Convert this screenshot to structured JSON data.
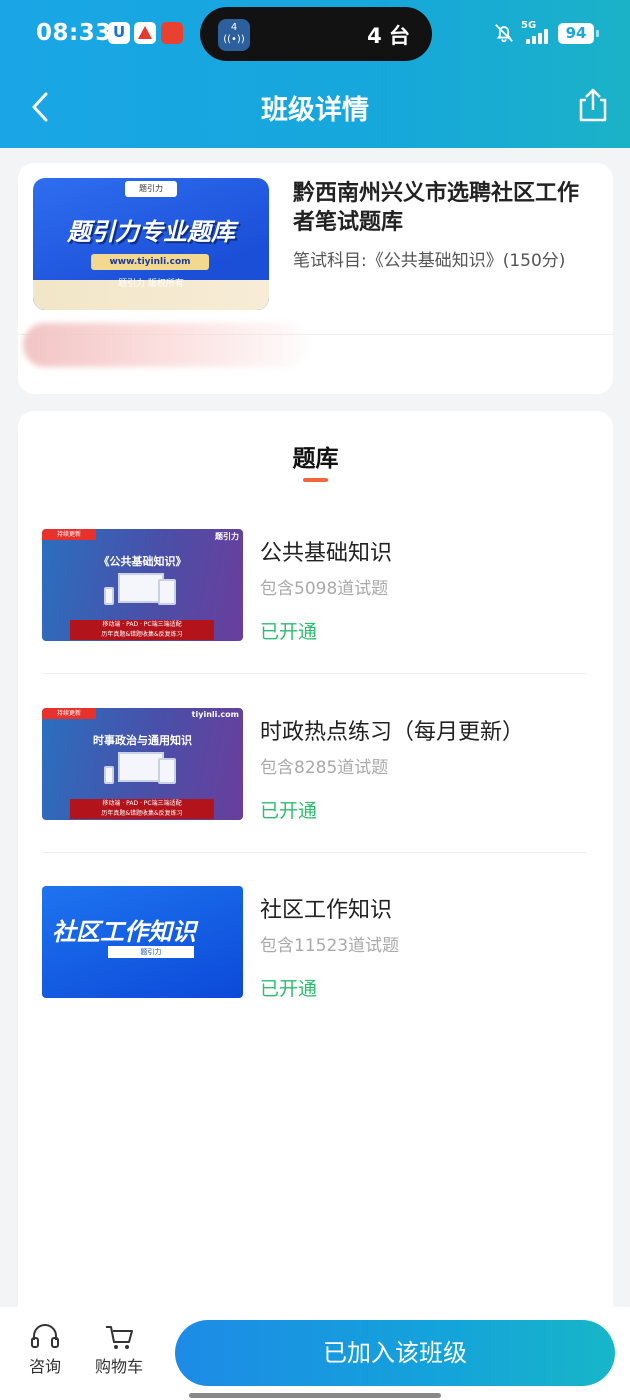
{
  "status_bar": {
    "time": "08:33",
    "island_count_icon": "4",
    "island_text": "4 台",
    "network": "5G",
    "battery": "94"
  },
  "nav": {
    "title": "班级详情",
    "back_icon": "chevron-left-icon",
    "share_icon": "share-icon"
  },
  "class_info": {
    "cover": {
      "logo": "题引力",
      "title": "题引力专业题库",
      "url": "www.tiyinli.com",
      "rights": "题引力 版权所有"
    },
    "title": "黔西南州兴义市选聘社区工作者笔试题库",
    "subject": "笔试科目:《公共基础知识》(150分)"
  },
  "question_bank": {
    "heading": "题库",
    "accent_color": "#f0673d",
    "items": [
      {
        "name": "公共基础知识",
        "count": "包含5098道试题",
        "status": "已开通",
        "thumb": {
          "tag": "持续更新",
          "brand": "题引力",
          "heading": "《公共基础知识》",
          "band_line1": "移动端 · PAD · PC端三端适配",
          "band_line2": "历年真题&错题收集&反复练习"
        }
      },
      {
        "name": "时政热点练习（每月更新）",
        "count": "包含8285道试题",
        "status": "已开通",
        "thumb": {
          "tag": "持续更新",
          "brand": "tiyinli.com",
          "heading": "时事政治与通用知识",
          "band_line1": "移动端 · PAD · PC端三端适配",
          "band_line2": "历年真题&错题收集&反复练习"
        }
      },
      {
        "name": "社区工作知识",
        "count": "包含11523道试题",
        "status": "已开通",
        "thumb": {
          "title": "社区工作知识",
          "sub": "题引力"
        }
      }
    ],
    "status_color": "#2ebd6e"
  },
  "bottom_bar": {
    "consult_label": "咨询",
    "consult_icon": "headset-icon",
    "cart_label": "购物车",
    "cart_icon": "cart-icon",
    "join_label": "已加入该班级"
  }
}
